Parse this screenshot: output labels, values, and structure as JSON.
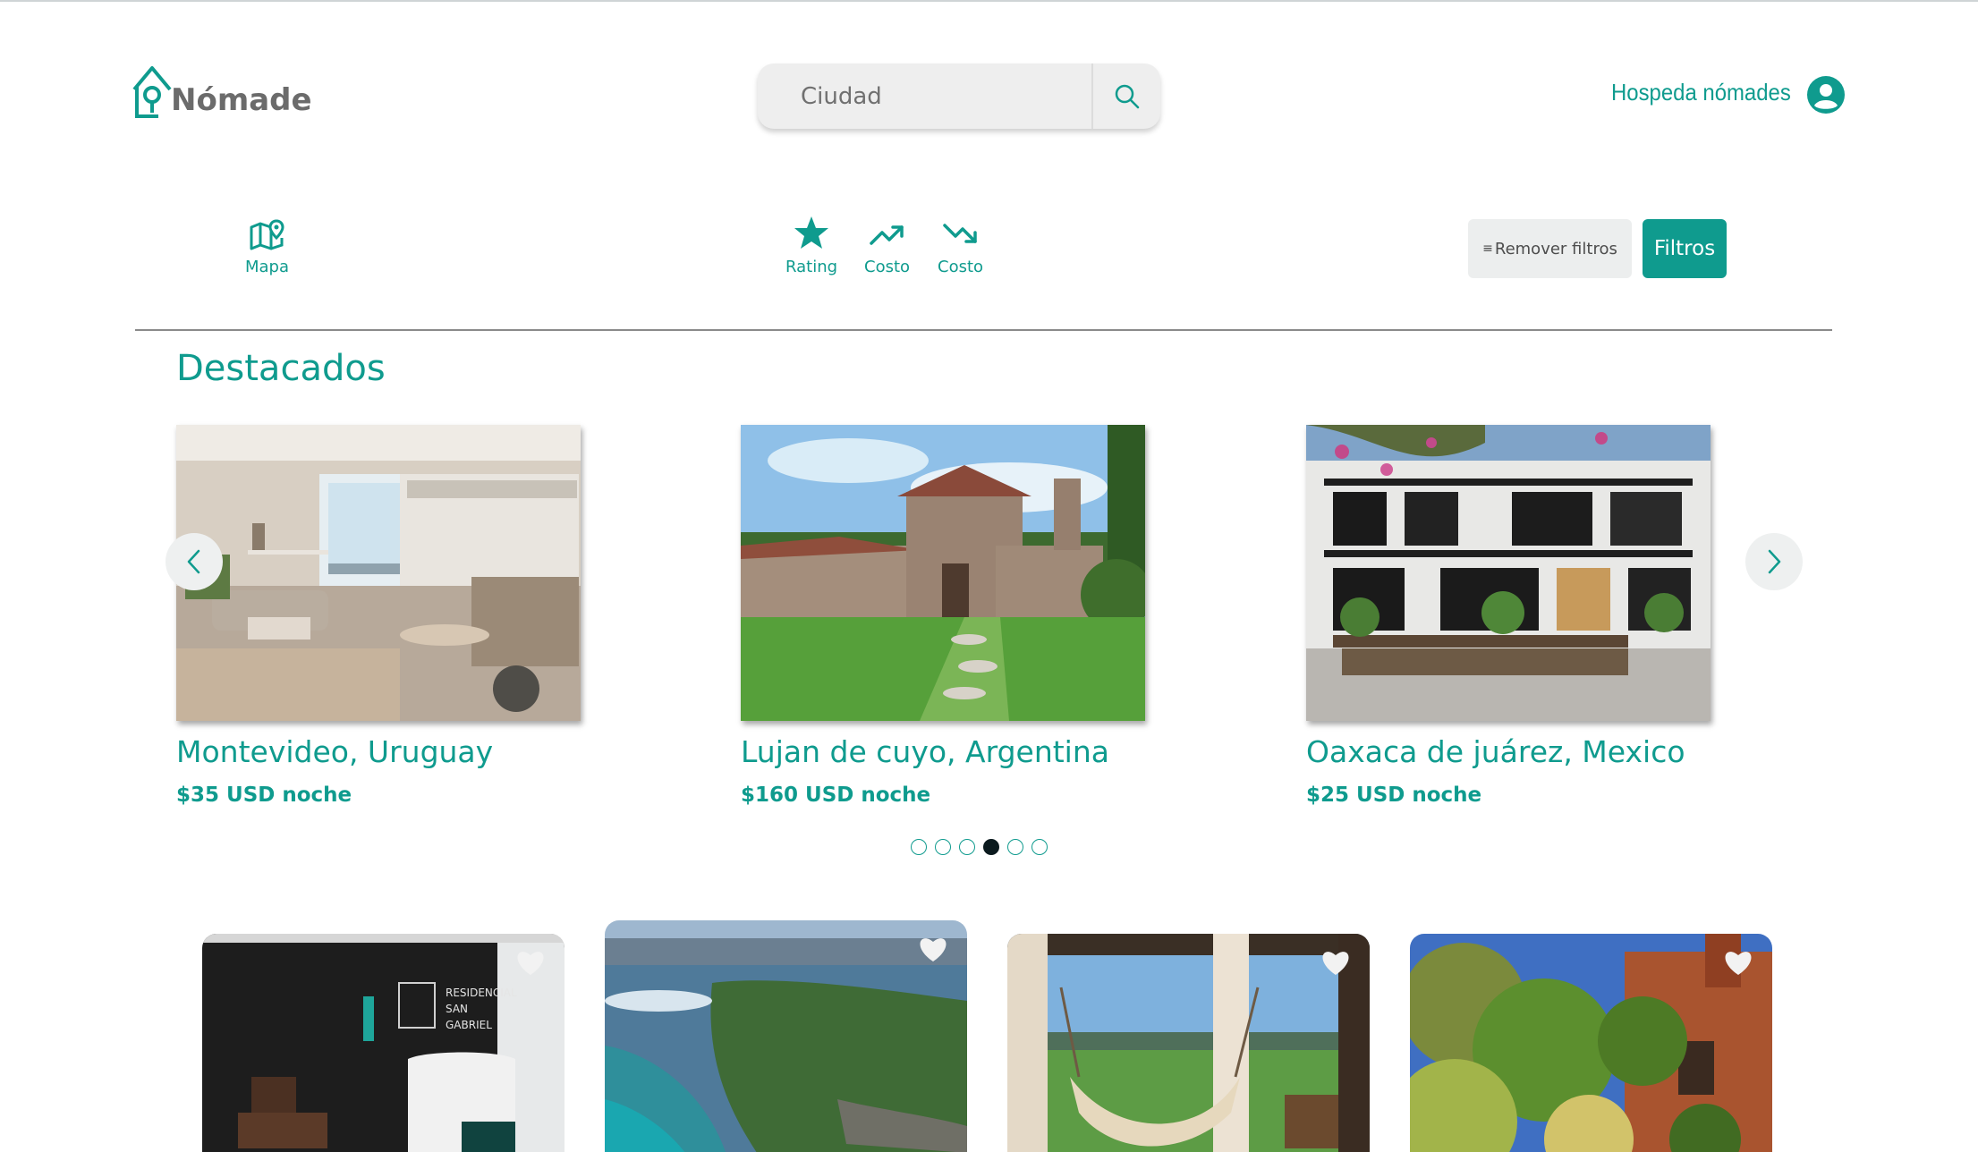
{
  "header": {
    "logo_text": "Nómade",
    "search_placeholder": "Ciudad",
    "host_link": "Hospeda nómades"
  },
  "toolbar": {
    "map_label": "Mapa",
    "rating_label": "Rating",
    "cost_up_label": "Costo",
    "cost_down_label": "Costo",
    "remove_filters_label": "Remover filtros",
    "filters_label": "Filtros"
  },
  "featured": {
    "title": "Destacados",
    "cards": [
      {
        "title": "Montevideo, Uruguay",
        "price": "$35 USD noche"
      },
      {
        "title": "Lujan de cuyo, Argentina",
        "price": "$160 USD noche"
      },
      {
        "title": "Oaxaca de juárez, Mexico",
        "price": "$25 USD noche"
      }
    ],
    "dots_total": 6,
    "dots_active_index": 3
  },
  "colors": {
    "accent": "#0f9b8e",
    "dot_active": "#0b1a1e"
  }
}
